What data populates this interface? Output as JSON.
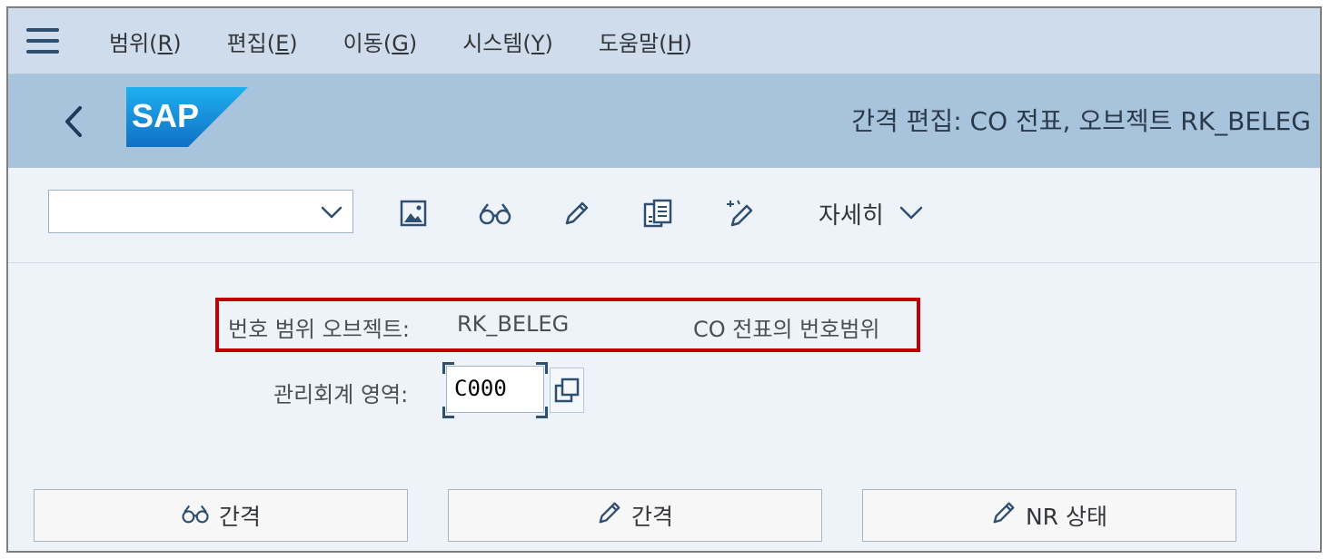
{
  "menu": {
    "items": [
      {
        "label": "범위(",
        "mnemonic": "R",
        "suffix": ")"
      },
      {
        "label": "편집(",
        "mnemonic": "E",
        "suffix": ")"
      },
      {
        "label": "이동(",
        "mnemonic": "G",
        "suffix": ")"
      },
      {
        "label": "시스템(",
        "mnemonic": "Y",
        "suffix": ")"
      },
      {
        "label": "도움말(",
        "mnemonic": "H",
        "suffix": ")"
      }
    ]
  },
  "header": {
    "logo_text": "SAP",
    "title": "간격 편집: CO 전표, 오브젝트 RK_BELEG"
  },
  "toolbar": {
    "dropdown_value": "",
    "more_label": "자세히"
  },
  "form": {
    "nr_object_label": "번호 범위 오브젝트:",
    "nr_object_value": "RK_BELEG",
    "nr_object_desc": "CO 전표의 번호범위",
    "controlling_area_label": "관리회계 영역:",
    "controlling_area_value": "C000"
  },
  "buttons": {
    "display_intervals": "간격",
    "change_intervals": "간격",
    "nr_status": "NR 상태"
  },
  "colors": {
    "menubar_bg": "#cfdceb",
    "titlebar_bg": "#a8c4dd",
    "highlight": "#c00000",
    "sap_blue": "#1a8ad6"
  }
}
